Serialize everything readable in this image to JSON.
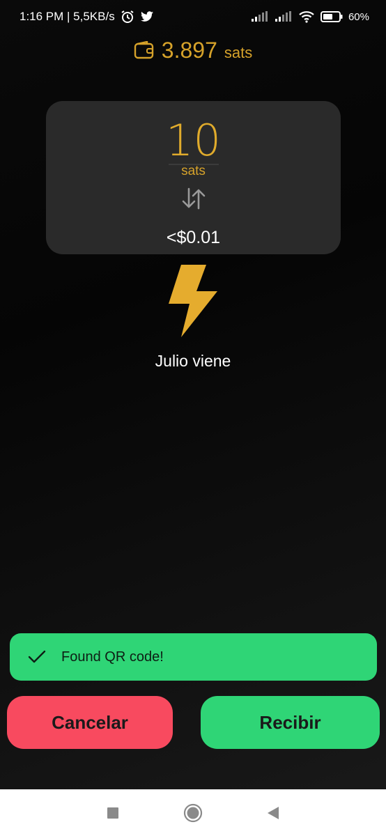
{
  "status_bar": {
    "time_speed": "1:16 PM | 5,5KB/s",
    "battery": "60%"
  },
  "balance": {
    "amount": "3.897",
    "unit": "sats",
    "color": "#d6a22a"
  },
  "amount_card": {
    "value": "10",
    "unit": "sats",
    "fiat": "<$0.01"
  },
  "payee": {
    "name": "Julio viene"
  },
  "toast": {
    "message": "Found QR code!",
    "color": "#2fd576"
  },
  "actions": {
    "cancel_label": "Cancelar",
    "receive_label": "Recibir",
    "cancel_color": "#f84a5f",
    "receive_color": "#2fd576"
  },
  "icons": [
    "alarm-icon",
    "twitter-icon",
    "signal-icon",
    "wifi-icon",
    "battery-icon",
    "wallet-icon",
    "swap-icon",
    "lightning-icon",
    "check-icon",
    "recents-icon",
    "home-icon",
    "back-icon"
  ]
}
